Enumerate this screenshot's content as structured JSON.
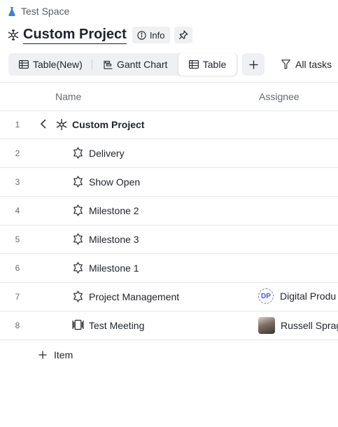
{
  "breadcrumb": {
    "space_name": "Test Space",
    "icon": "flask-icon"
  },
  "header": {
    "title": "Custom Project",
    "info_label": "Info",
    "project_icon": "snowflake-icon",
    "pin_icon": "pin-icon"
  },
  "views": {
    "tabs": [
      {
        "label": "Table(New)",
        "icon": "table-icon",
        "active": false
      },
      {
        "label": "Gantt Chart",
        "icon": "gantt-icon",
        "active": false
      },
      {
        "label": "Table",
        "icon": "table-icon",
        "active": true
      }
    ],
    "add_icon": "plus-icon",
    "filter_label": "All tasks"
  },
  "table": {
    "columns": [
      "Name",
      "Assignee"
    ],
    "rows": [
      {
        "num": "1",
        "name": "Custom Project",
        "icon": "snowflake-icon",
        "collapse_icon": "chevron-left-icon",
        "bold": true,
        "assignee": ""
      },
      {
        "num": "2",
        "name": "Delivery",
        "icon": "milestone-icon",
        "assignee": ""
      },
      {
        "num": "3",
        "name": "Show Open",
        "icon": "milestone-icon",
        "assignee": ""
      },
      {
        "num": "4",
        "name": "Milestone 2",
        "icon": "milestone-icon",
        "assignee": ""
      },
      {
        "num": "5",
        "name": "Milestone 3",
        "icon": "milestone-icon",
        "assignee": ""
      },
      {
        "num": "6",
        "name": "Milestone 1",
        "icon": "milestone-icon",
        "assignee": ""
      },
      {
        "num": "7",
        "name": "Project Management",
        "icon": "milestone-icon",
        "assignee": "Digital Produ",
        "assignee_initials": "DP"
      },
      {
        "num": "8",
        "name": "Test Meeting",
        "icon": "meeting-icon",
        "assignee": "Russell Sprag"
      }
    ]
  },
  "add_item_label": "Item",
  "colors": {
    "text": "#1f2329",
    "muted": "#646a73",
    "divider": "#e6e8eb",
    "tab_bg": "#eef0f3",
    "breadcrumb_icon": "#3b82d6"
  }
}
